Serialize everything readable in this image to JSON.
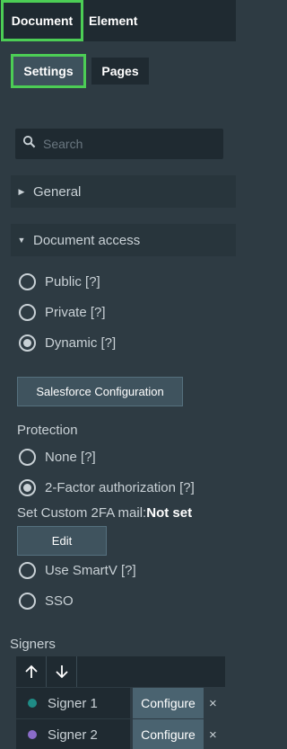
{
  "top_tabs": {
    "document": "Document",
    "element": "Element"
  },
  "sub_tabs": {
    "settings": "Settings",
    "pages": "Pages"
  },
  "search": {
    "placeholder": "Search"
  },
  "sections": {
    "general": "General",
    "document_access": "Document access"
  },
  "access_options": {
    "public": "Public [?]",
    "private": "Private [?]",
    "dynamic": "Dynamic [?]",
    "selected": "dynamic"
  },
  "salesforce_button": "Salesforce Configuration",
  "protection": {
    "label": "Protection",
    "none": "None [?]",
    "two_factor": "2-Factor authorization [?]",
    "selected": "two_factor",
    "custom_mail_label": "Set Custom 2FA mail:",
    "custom_mail_value": "Not set",
    "edit_button": "Edit",
    "smartv": "Use SmartV [?]",
    "sso": "SSO"
  },
  "signers": {
    "label": "Signers",
    "configure_label": "Configure",
    "remove_glyph": "×",
    "items": [
      {
        "name": "Signer 1",
        "color": "#1f8c86"
      },
      {
        "name": "Signer 2",
        "color": "#8a6cc9"
      }
    ]
  },
  "colors": {
    "accent": "#4ccd55"
  }
}
